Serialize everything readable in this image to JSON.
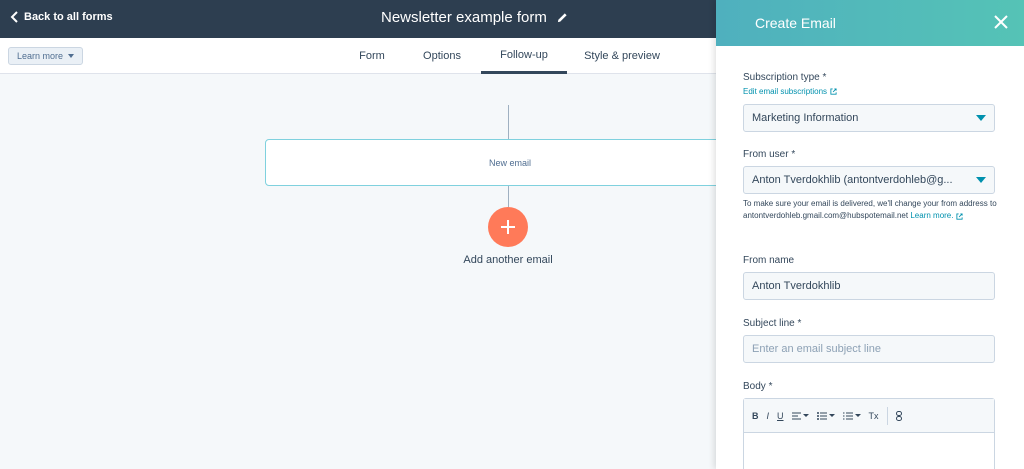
{
  "topbar": {
    "back_label": "Back to all forms",
    "form_title": "Newsletter example form"
  },
  "subnav": {
    "learn_more": "Learn more",
    "tabs": [
      {
        "label": "Form"
      },
      {
        "label": "Options"
      },
      {
        "label": "Follow-up"
      },
      {
        "label": "Style & preview"
      }
    ],
    "active_tab": "Follow-up"
  },
  "canvas": {
    "email_card_label": "New email",
    "add_label": "Add another email"
  },
  "panel": {
    "title": "Create Email",
    "subscription_type_label": "Subscription type *",
    "edit_subscriptions_link": "Edit email subscriptions",
    "subscription_type_value": "Marketing Information",
    "from_user_label": "From user *",
    "from_user_value": "Anton Tverdokhlib (antontverdohleb@g...",
    "from_user_help_1": "To make sure your email is delivered, we'll change your from address to",
    "from_user_help_2": "antontverdohleb.gmail.com@hubspotemail.net",
    "from_user_help_link": "Learn more.",
    "from_name_label": "From name",
    "from_name_value": "Anton Tverdokhlib",
    "subject_label": "Subject line *",
    "subject_placeholder": "Enter an email subject line",
    "body_label": "Body *",
    "toolbar": {
      "bold": "B",
      "italic": "I",
      "underline": "U",
      "clear": "Tx"
    }
  },
  "colors": {
    "topbar": "#2d3e50",
    "accent": "#ff7a59",
    "panel_header": "#4fb0be",
    "link": "#0091ae"
  }
}
